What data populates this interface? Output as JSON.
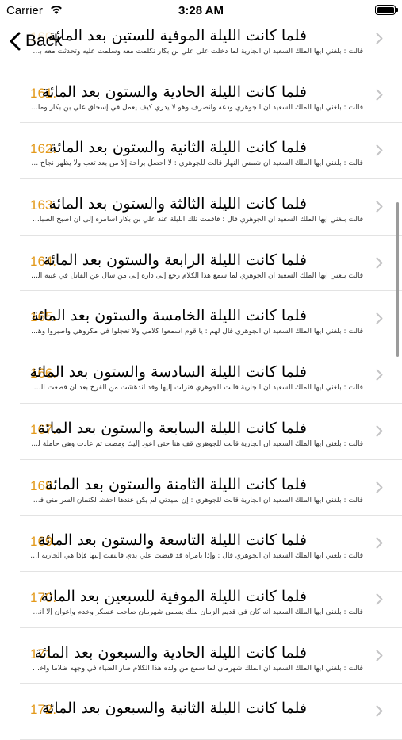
{
  "status_bar": {
    "carrier": "Carrier",
    "time": "3:28 AM"
  },
  "nav": {
    "back_label": "Back"
  },
  "rows": [
    {
      "num": "160.",
      "title": "فلما كانت الليلة الموفية للستين بعد المائة",
      "snippet": "قالت : بلغني أيها الملك السعيد أن الجارية لما دخلت على علي بن بكار تكلمت معه وسلمت عليه وتحدثت معه بسرور..."
    },
    {
      "num": "161.",
      "title": "فلما كانت الليلة الحادية والستون بعد المائة",
      "snippet": "قالت : بلغني أيها الملك السعيد أن الجوهري ودعه وانصرف وهو لا يدري كيف يعمل في إسحاق علي بن بكار وما زال ماش..."
    },
    {
      "num": "162.",
      "title": "فلما كانت الليلة الثانية والستون بعد المائة",
      "snippet": "قالت : بلغني أيها الملك السعيد أن شمس النهار قالت للجوهري : لا أحصل براحة إلا من بعد تعب ولا يظهر نجاح إلا من ذوي..."
    },
    {
      "num": "163.",
      "title": "فلما كانت الليلة الثالثة والستون بعد المائة",
      "snippet": "قالت بلغني أيها الملك السعيد أن الجوهري قال : فأقمت تلك الليلة عند علي بن بكار أسامره إلى أن أصبح الصباح ، ثم صليت ا..."
    },
    {
      "num": "164.",
      "title": "فلما كانت الليلة الرابعة والستون بعد المائة",
      "snippet": "قالت بلغني أيها الملك السعيد أن الجوهري لما سمع هذا الكلام رجع إلى داره إلى من سأل عن القاتل في غيبة الذي حصل لي..."
    },
    {
      "num": "165.",
      "title": "فلما كانت الليلة الخامسة والستون بعد المائة",
      "snippet": "قالت : بلغني أيها الملك السعيد أن الجوهري قال لهم : يا قوم اسمعوا كلامي ولا تعجلوا في مكروهي واصبروا وهونوا وتجبرون..."
    },
    {
      "num": "166.",
      "title": "فلما كانت الليلة السادسة والستون بعد المائة",
      "snippet": "قالت : بلغني أيها الملك السعيد أن الجارية قالت للجوهري فنزلت إليها وقد اندهشت من الفرح بعد أن قطعت الرجاء منها ."
    },
    {
      "num": "167.",
      "title": "فلما كانت الليلة السابعة والستون بعد المائة",
      "snippet": "قالت : بلغني أيها الملك السعيد أن الجارية قالت للجوهري قف هنا حتى أعود إليك ومضت ثم عادت وهي حاملة لمال فاعطه..."
    },
    {
      "num": "168.",
      "title": "فلما كانت الليلة الثامنة والستون بعد المائة",
      "snippet": "قالت : بلغني أيها الملك السعيد أن الجارية قالت للجوهري : إن سيدتي لم يكن عندها أحفظ لكتمان السر منى فوجدها س..."
    },
    {
      "num": "169.",
      "title": "فلما كانت الليلة التاسعة والستون بعد المائة",
      "snippet": "قالت : بلغني أيها الملك السعيد أن الجوهري قال : وإذا بأمرأة قد قبضت علي يدي فالتفت إليها فإذا هي الجارية التي أتت إلى من عن..."
    },
    {
      "num": "170.",
      "title": "فلما كانت الليلة الموفية للسبعين بعد المائة",
      "snippet": "قالت : بلغني أيها الملك السعيد أنه كان في قديم الزمان ملك يسمى شهرمان صاحب عسكر وخدم وأعوان إلا أنه كبر سنه..."
    },
    {
      "num": "171.",
      "title": "فلما كانت الليلة الحادية والسبعون بعد المائة",
      "snippet": "قالت : بلغني أيها الملك السعيد أن الملك شهرمان لما سمع من ولده هذا الكلام صار الضياء في وجهه ظلاما وأخذ على عذمه..."
    },
    {
      "num": "172.",
      "title": "فلما كانت الليلة الثانية والسبعون بعد المائة",
      "snippet": ""
    }
  ]
}
